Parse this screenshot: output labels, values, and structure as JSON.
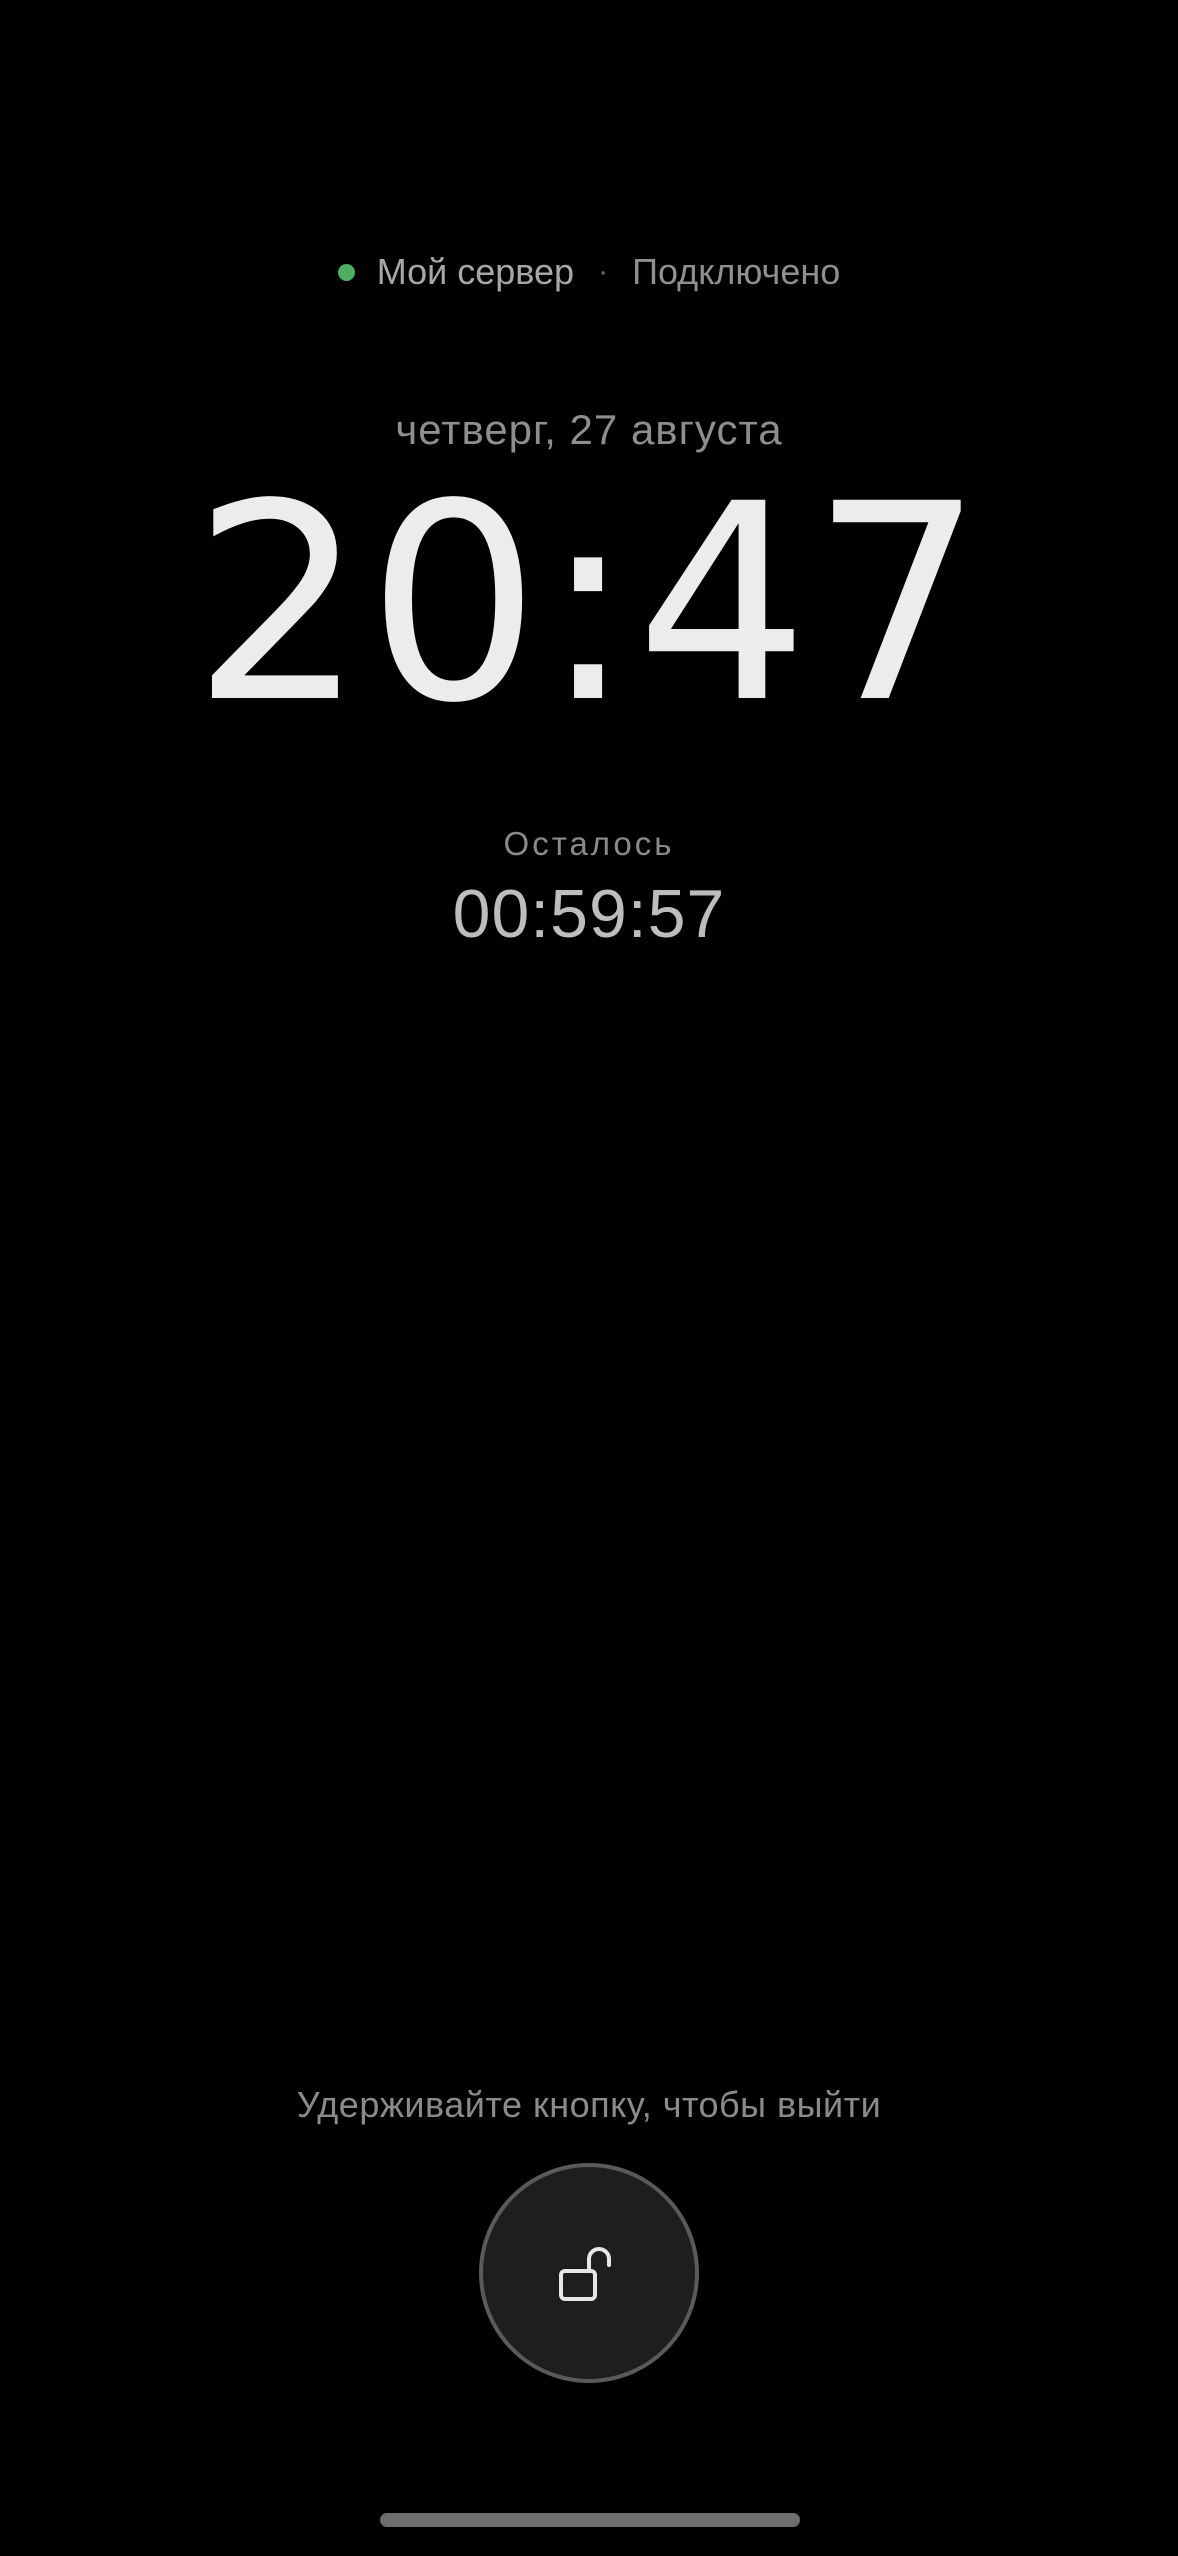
{
  "status": {
    "server_name": "Мой сервер",
    "separator": "·",
    "connection": "Подключено",
    "dot_color": "#4caf62"
  },
  "date": "четверг, 27 августа",
  "clock": "20:47",
  "timer": {
    "label": "Осталось",
    "value": "00:59:57"
  },
  "exit": {
    "hint": "Удерживайте кнопку, чтобы выйти",
    "button_icon": "unlock-icon"
  }
}
